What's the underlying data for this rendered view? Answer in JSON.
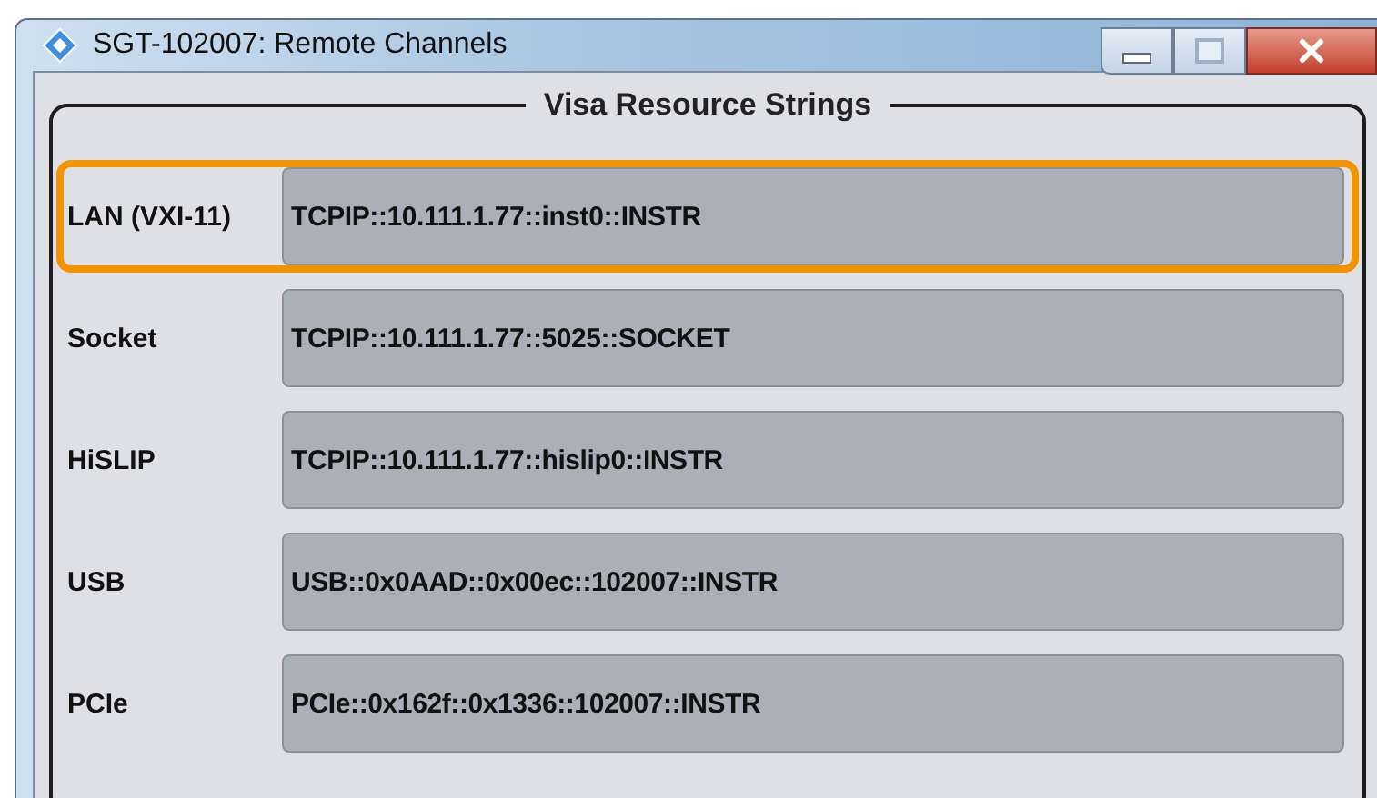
{
  "window": {
    "title": "SGT-102007: Remote Channels"
  },
  "group": {
    "title": "Visa Resource Strings"
  },
  "rows": [
    {
      "label": "LAN (VXI-11)",
      "value": "TCPIP::10.111.1.77::inst0::INSTR",
      "selected": true
    },
    {
      "label": "Socket",
      "value": "TCPIP::10.111.1.77::5025::SOCKET",
      "selected": false
    },
    {
      "label": "HiSLIP",
      "value": "TCPIP::10.111.1.77::hislip0::INSTR",
      "selected": false
    },
    {
      "label": "USB",
      "value": "USB::0x0AAD::0x00ec::102007::INSTR",
      "selected": false
    },
    {
      "label": "PCIe",
      "value": "PCIe::0x162f::0x1336::102007::INSTR",
      "selected": false
    }
  ]
}
